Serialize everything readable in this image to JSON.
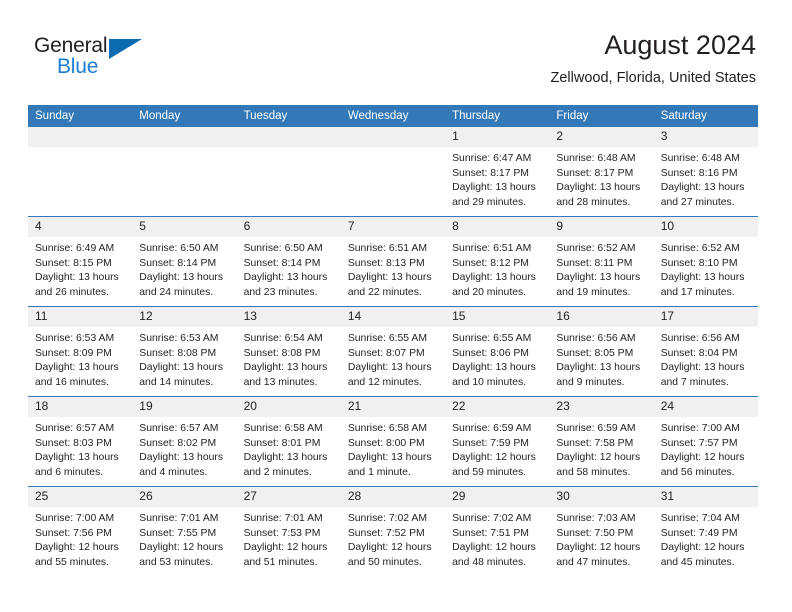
{
  "logo": {
    "word_top": "General",
    "word_bottom": "Blue",
    "triangle": "triangle-icon",
    "color_dark": "#231f20",
    "color_blue": "#1a7fd4",
    "color_triangle": "#0d6bb0"
  },
  "header": {
    "title": "August 2024",
    "subtitle": "Zellwood, Florida, United States"
  },
  "theme": {
    "header_row_bg": "#3379b8",
    "header_row_text": "#ffffff",
    "daynum_bg": "#f0f0f0",
    "row_divider": "#3379b8",
    "body_text": "#231f20"
  },
  "weekdays": [
    "Sunday",
    "Monday",
    "Tuesday",
    "Wednesday",
    "Thursday",
    "Friday",
    "Saturday"
  ],
  "weeks": [
    [
      {
        "day": "",
        "sunrise": "",
        "sunset": "",
        "daylight_1": "",
        "daylight_2": ""
      },
      {
        "day": "",
        "sunrise": "",
        "sunset": "",
        "daylight_1": "",
        "daylight_2": ""
      },
      {
        "day": "",
        "sunrise": "",
        "sunset": "",
        "daylight_1": "",
        "daylight_2": ""
      },
      {
        "day": "",
        "sunrise": "",
        "sunset": "",
        "daylight_1": "",
        "daylight_2": ""
      },
      {
        "day": "1",
        "sunrise": "Sunrise: 6:47 AM",
        "sunset": "Sunset: 8:17 PM",
        "daylight_1": "Daylight: 13 hours",
        "daylight_2": "and 29 minutes."
      },
      {
        "day": "2",
        "sunrise": "Sunrise: 6:48 AM",
        "sunset": "Sunset: 8:17 PM",
        "daylight_1": "Daylight: 13 hours",
        "daylight_2": "and 28 minutes."
      },
      {
        "day": "3",
        "sunrise": "Sunrise: 6:48 AM",
        "sunset": "Sunset: 8:16 PM",
        "daylight_1": "Daylight: 13 hours",
        "daylight_2": "and 27 minutes."
      }
    ],
    [
      {
        "day": "4",
        "sunrise": "Sunrise: 6:49 AM",
        "sunset": "Sunset: 8:15 PM",
        "daylight_1": "Daylight: 13 hours",
        "daylight_2": "and 26 minutes."
      },
      {
        "day": "5",
        "sunrise": "Sunrise: 6:50 AM",
        "sunset": "Sunset: 8:14 PM",
        "daylight_1": "Daylight: 13 hours",
        "daylight_2": "and 24 minutes."
      },
      {
        "day": "6",
        "sunrise": "Sunrise: 6:50 AM",
        "sunset": "Sunset: 8:14 PM",
        "daylight_1": "Daylight: 13 hours",
        "daylight_2": "and 23 minutes."
      },
      {
        "day": "7",
        "sunrise": "Sunrise: 6:51 AM",
        "sunset": "Sunset: 8:13 PM",
        "daylight_1": "Daylight: 13 hours",
        "daylight_2": "and 22 minutes."
      },
      {
        "day": "8",
        "sunrise": "Sunrise: 6:51 AM",
        "sunset": "Sunset: 8:12 PM",
        "daylight_1": "Daylight: 13 hours",
        "daylight_2": "and 20 minutes."
      },
      {
        "day": "9",
        "sunrise": "Sunrise: 6:52 AM",
        "sunset": "Sunset: 8:11 PM",
        "daylight_1": "Daylight: 13 hours",
        "daylight_2": "and 19 minutes."
      },
      {
        "day": "10",
        "sunrise": "Sunrise: 6:52 AM",
        "sunset": "Sunset: 8:10 PM",
        "daylight_1": "Daylight: 13 hours",
        "daylight_2": "and 17 minutes."
      }
    ],
    [
      {
        "day": "11",
        "sunrise": "Sunrise: 6:53 AM",
        "sunset": "Sunset: 8:09 PM",
        "daylight_1": "Daylight: 13 hours",
        "daylight_2": "and 16 minutes."
      },
      {
        "day": "12",
        "sunrise": "Sunrise: 6:53 AM",
        "sunset": "Sunset: 8:08 PM",
        "daylight_1": "Daylight: 13 hours",
        "daylight_2": "and 14 minutes."
      },
      {
        "day": "13",
        "sunrise": "Sunrise: 6:54 AM",
        "sunset": "Sunset: 8:08 PM",
        "daylight_1": "Daylight: 13 hours",
        "daylight_2": "and 13 minutes."
      },
      {
        "day": "14",
        "sunrise": "Sunrise: 6:55 AM",
        "sunset": "Sunset: 8:07 PM",
        "daylight_1": "Daylight: 13 hours",
        "daylight_2": "and 12 minutes."
      },
      {
        "day": "15",
        "sunrise": "Sunrise: 6:55 AM",
        "sunset": "Sunset: 8:06 PM",
        "daylight_1": "Daylight: 13 hours",
        "daylight_2": "and 10 minutes."
      },
      {
        "day": "16",
        "sunrise": "Sunrise: 6:56 AM",
        "sunset": "Sunset: 8:05 PM",
        "daylight_1": "Daylight: 13 hours",
        "daylight_2": "and 9 minutes."
      },
      {
        "day": "17",
        "sunrise": "Sunrise: 6:56 AM",
        "sunset": "Sunset: 8:04 PM",
        "daylight_1": "Daylight: 13 hours",
        "daylight_2": "and 7 minutes."
      }
    ],
    [
      {
        "day": "18",
        "sunrise": "Sunrise: 6:57 AM",
        "sunset": "Sunset: 8:03 PM",
        "daylight_1": "Daylight: 13 hours",
        "daylight_2": "and 6 minutes."
      },
      {
        "day": "19",
        "sunrise": "Sunrise: 6:57 AM",
        "sunset": "Sunset: 8:02 PM",
        "daylight_1": "Daylight: 13 hours",
        "daylight_2": "and 4 minutes."
      },
      {
        "day": "20",
        "sunrise": "Sunrise: 6:58 AM",
        "sunset": "Sunset: 8:01 PM",
        "daylight_1": "Daylight: 13 hours",
        "daylight_2": "and 2 minutes."
      },
      {
        "day": "21",
        "sunrise": "Sunrise: 6:58 AM",
        "sunset": "Sunset: 8:00 PM",
        "daylight_1": "Daylight: 13 hours",
        "daylight_2": "and 1 minute."
      },
      {
        "day": "22",
        "sunrise": "Sunrise: 6:59 AM",
        "sunset": "Sunset: 7:59 PM",
        "daylight_1": "Daylight: 12 hours",
        "daylight_2": "and 59 minutes."
      },
      {
        "day": "23",
        "sunrise": "Sunrise: 6:59 AM",
        "sunset": "Sunset: 7:58 PM",
        "daylight_1": "Daylight: 12 hours",
        "daylight_2": "and 58 minutes."
      },
      {
        "day": "24",
        "sunrise": "Sunrise: 7:00 AM",
        "sunset": "Sunset: 7:57 PM",
        "daylight_1": "Daylight: 12 hours",
        "daylight_2": "and 56 minutes."
      }
    ],
    [
      {
        "day": "25",
        "sunrise": "Sunrise: 7:00 AM",
        "sunset": "Sunset: 7:56 PM",
        "daylight_1": "Daylight: 12 hours",
        "daylight_2": "and 55 minutes."
      },
      {
        "day": "26",
        "sunrise": "Sunrise: 7:01 AM",
        "sunset": "Sunset: 7:55 PM",
        "daylight_1": "Daylight: 12 hours",
        "daylight_2": "and 53 minutes."
      },
      {
        "day": "27",
        "sunrise": "Sunrise: 7:01 AM",
        "sunset": "Sunset: 7:53 PM",
        "daylight_1": "Daylight: 12 hours",
        "daylight_2": "and 51 minutes."
      },
      {
        "day": "28",
        "sunrise": "Sunrise: 7:02 AM",
        "sunset": "Sunset: 7:52 PM",
        "daylight_1": "Daylight: 12 hours",
        "daylight_2": "and 50 minutes."
      },
      {
        "day": "29",
        "sunrise": "Sunrise: 7:02 AM",
        "sunset": "Sunset: 7:51 PM",
        "daylight_1": "Daylight: 12 hours",
        "daylight_2": "and 48 minutes."
      },
      {
        "day": "30",
        "sunrise": "Sunrise: 7:03 AM",
        "sunset": "Sunset: 7:50 PM",
        "daylight_1": "Daylight: 12 hours",
        "daylight_2": "and 47 minutes."
      },
      {
        "day": "31",
        "sunrise": "Sunrise: 7:04 AM",
        "sunset": "Sunset: 7:49 PM",
        "daylight_1": "Daylight: 12 hours",
        "daylight_2": "and 45 minutes."
      }
    ]
  ]
}
